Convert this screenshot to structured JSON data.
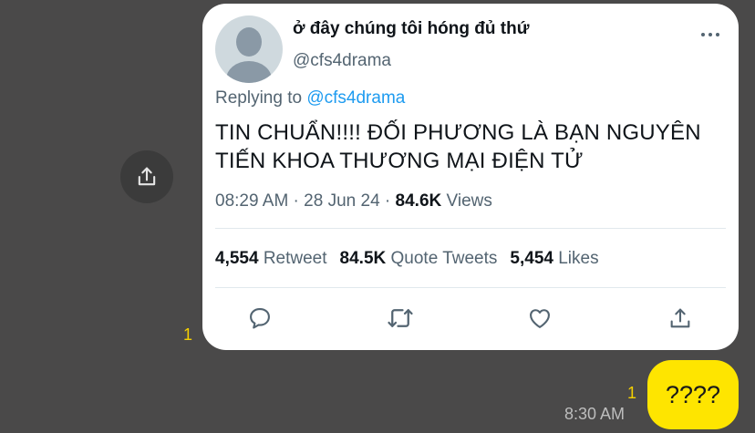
{
  "tweet": {
    "display_name": "ở đây chúng tôi hóng đủ thứ",
    "handle": "@cfs4drama",
    "replying_prefix": "Replying to ",
    "replying_mention": "@cfs4drama",
    "text": "TIN CHUẨN!!!! ĐỐI PHƯƠNG LÀ BẠN NGUYÊN TIẾN KHOA THƯƠNG MẠI ĐIỆN TỬ",
    "time": "08:29 AM",
    "date": "28 Jun 24",
    "views_count": "84.6K",
    "views_label": "Views",
    "retweet_count": "4,554",
    "retweet_label": "Retweet",
    "quote_count": "84.5K",
    "quote_label": "Quote Tweets",
    "likes_count": "5,454",
    "likes_label": "Likes",
    "more_icon": "more-horizontal-icon",
    "actions": [
      "reply-icon",
      "retweet-icon",
      "like-icon",
      "share-icon"
    ]
  },
  "chat": {
    "unread_counter_1": "1",
    "unread_counter_2": "1",
    "message_time": "8:30 AM",
    "message_text": "????",
    "forward_icon": "share-icon"
  },
  "colors": {
    "background": "#4a4949",
    "bubble": "#fee500",
    "counter": "#f5d000",
    "mention": "#1d9bf0"
  }
}
